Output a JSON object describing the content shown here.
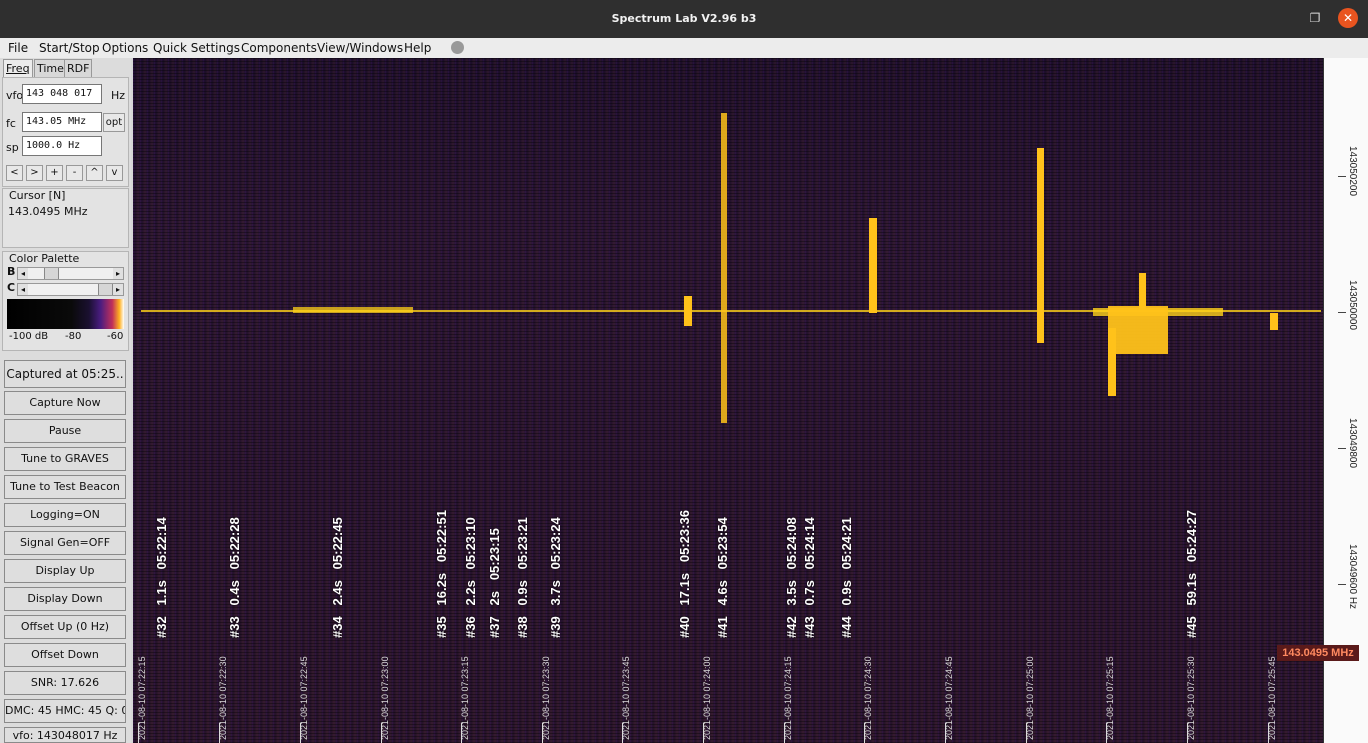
{
  "window": {
    "title": "Spectrum Lab V2.96 b3"
  },
  "menu": [
    "File",
    "Start/Stop",
    "Options",
    "Quick Settings",
    "Components",
    "View/Windows",
    "Help"
  ],
  "tabs": [
    "Freq",
    "Time",
    "RDF"
  ],
  "freq": {
    "vfo_label": "vfo",
    "vfo_value": "143 048 017",
    "vfo_unit": "Hz",
    "fc_label": "fc",
    "fc_value": "143.05 MHz",
    "opt_label": "opt",
    "sp_label": "sp",
    "sp_value": "1000.0 Hz",
    "nav": [
      "<",
      ">",
      "+",
      "-",
      "^",
      "v"
    ]
  },
  "cursor": {
    "title": "Cursor [N]",
    "value": "143.0495 MHz"
  },
  "palette": {
    "title": "Color Palette",
    "b_label": "B",
    "c_label": "C",
    "scale": [
      "-100 dB",
      "-80",
      "-60"
    ]
  },
  "buttons": [
    "Captured at 05:25..",
    "Capture Now",
    "Pause",
    "Tune to GRAVES",
    "Tune to Test Beacon",
    "Logging=ON",
    "Signal Gen=OFF",
    "Display Up",
    "Display Down",
    "Offset Up (0 Hz)",
    "Offset Down",
    "SNR: 17.626",
    "DMC: 45 HMC: 45 Q: 0",
    "vfo: 143048017 Hz"
  ],
  "annotations": [
    "#32   1.1s   05:22:14",
    "#33   0.4s   05:22:28",
    "#34   2.4s   05:22:45",
    "#35   16.2s   05:22:51",
    "#36   2.2s   05:23:10",
    "#37   2s   05:23:15",
    "#38   0.9s   05:23:21",
    "#39   3.7s   05:23:24",
    "#40   17.1s   05:23:36",
    "#41   4.6s   05:23:54",
    "#42   3.5s   05:24:08",
    "#43   0.7s   05:24:14",
    "#44   0.9s   05:24:21",
    "#45   59.1s   05:24:27"
  ],
  "timestamps": [
    "2021-08-10 07:22:15",
    "2021-08-10 07:22:30",
    "2021-08-10 07:22:45",
    "2021-08-10 07:23:00",
    "2021-08-10 07:23:15",
    "2021-08-10 07:23:30",
    "2021-08-10 07:23:45",
    "2021-08-10 07:24:00",
    "2021-08-10 07:24:15",
    "2021-08-10 07:24:30",
    "2021-08-10 07:24:45",
    "2021-08-10 07:25:00",
    "2021-08-10 07:25:15",
    "2021-08-10 07:25:30",
    "2021-08-10 07:25:45"
  ],
  "freq_scale": [
    "143050200",
    "143050000",
    "143049800",
    "143049600 Hz"
  ],
  "freq_marker": "143.0495 MHz",
  "colors": {
    "signal": "#ffd21a",
    "background": "#2a1535",
    "marker": "#5a1a1a"
  }
}
